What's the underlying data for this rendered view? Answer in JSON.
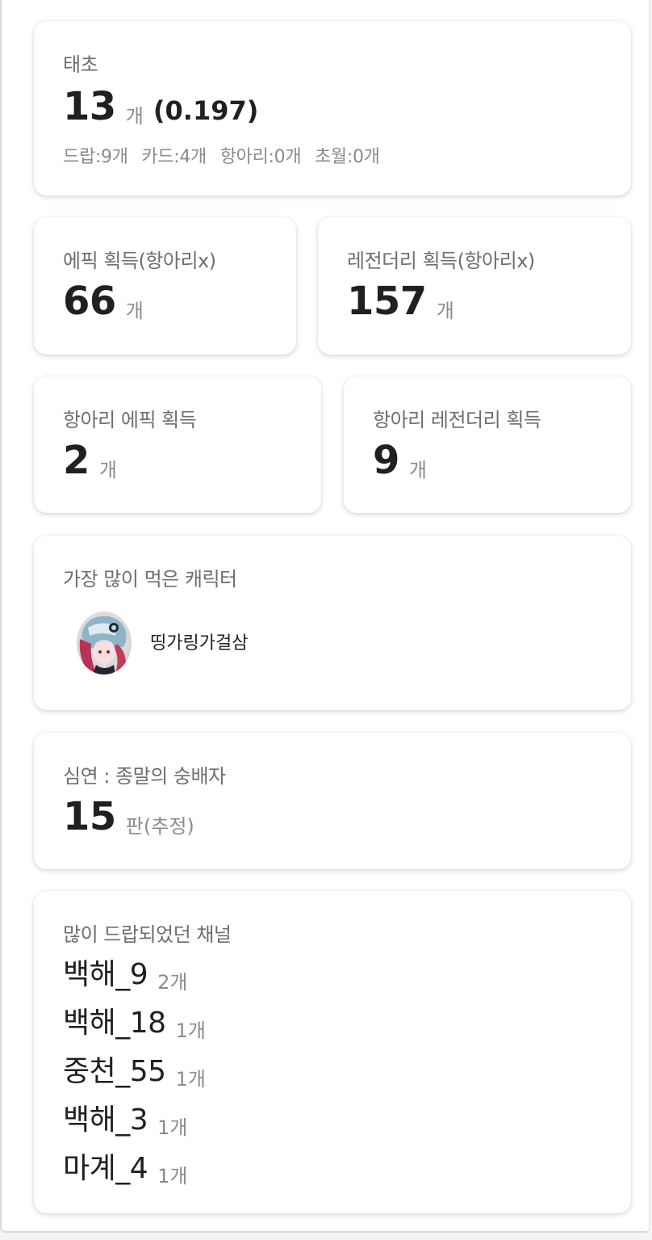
{
  "summary": {
    "title": "태초",
    "count": "13",
    "unit": "개",
    "ratio": "(0.197)",
    "breakdown": [
      "드랍:9개",
      "카드:4개",
      "항아리:0개",
      "초월:0개"
    ]
  },
  "epic": {
    "label": "에픽 획득(항아리x)",
    "value": "66",
    "unit": "개"
  },
  "legendary": {
    "label": "레전더리 획득(항아리x)",
    "value": "157",
    "unit": "개"
  },
  "jar_epic": {
    "label": "항아리 에픽 획득",
    "value": "2",
    "unit": "개"
  },
  "jar_legendary": {
    "label": "항아리 레전더리 획득",
    "value": "9",
    "unit": "개"
  },
  "top_character": {
    "label": "가장 많이 먹은 캐릭터",
    "name": "띵가링가걸삼"
  },
  "abyss": {
    "label": "심연 : 종말의 숭배자",
    "value": "15",
    "unit": "판(추정)"
  },
  "channels": {
    "label": "많이 드랍되었던 채널",
    "items": [
      {
        "name": "백해_9",
        "count": "2개"
      },
      {
        "name": "백해_18",
        "count": "1개"
      },
      {
        "name": "중천_55",
        "count": "1개"
      },
      {
        "name": "백해_3",
        "count": "1개"
      },
      {
        "name": "마계_4",
        "count": "1개"
      }
    ]
  }
}
